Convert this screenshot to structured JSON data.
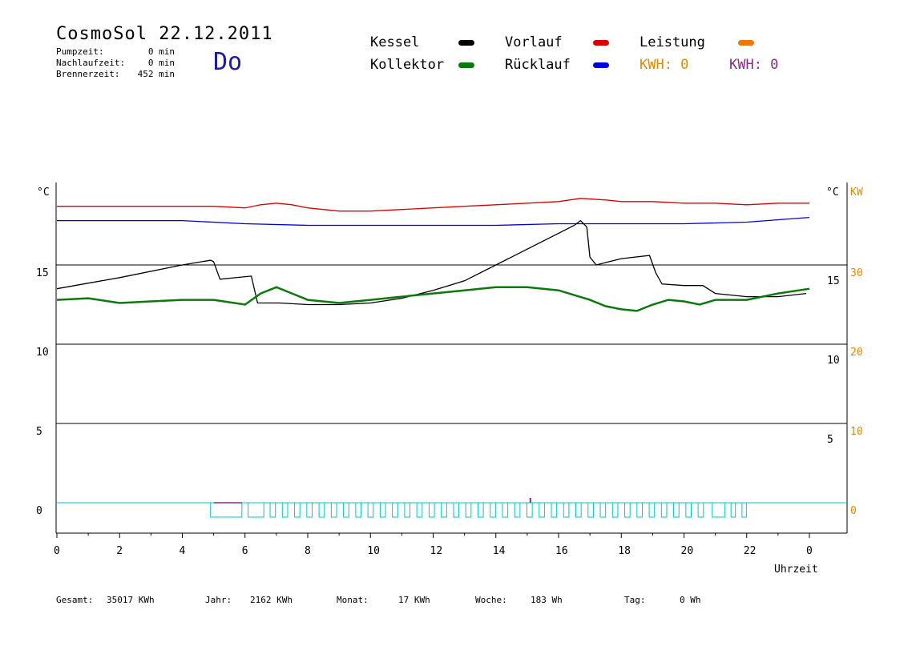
{
  "header": {
    "title": "CosmoSol 22.12.2011",
    "weekday": "Do",
    "stats": [
      {
        "label": "Pumpzeit:",
        "value": "0 min"
      },
      {
        "label": "Nachlaufzeit:",
        "value": "0 min"
      },
      {
        "label": "Brennerzeit:",
        "value": "452 min"
      }
    ]
  },
  "legend": {
    "items": [
      {
        "label": "Kessel",
        "color": "#000000"
      },
      {
        "label": "Kollektor",
        "color": "#0a7a0a"
      },
      {
        "label": "Vorlauf",
        "color": "#dd0000"
      },
      {
        "label": "Rücklauf",
        "color": "#0000dd"
      },
      {
        "label": "Leistung",
        "color": "#f07800"
      }
    ],
    "kwh_orange": "KWH: 0",
    "kwh_purple": "KWH: 0",
    "kwh_orange_color": "#e08a00",
    "kwh_purple_color": "#8a2a8a"
  },
  "footer": {
    "gesamt_label": "Gesamt:",
    "gesamt_value": "35017 KWh",
    "jahr_label": "Jahr:",
    "jahr_value": "2162 KWh",
    "monat_label": "Monat:",
    "monat_value": "17 KWh",
    "woche_label": "Woche:",
    "woche_value": "183 Wh",
    "tag_label": "Tag:",
    "tag_value": "0 Wh"
  },
  "chart_data": {
    "type": "line",
    "xlabel": "Uhrzeit",
    "x_tick_labels": [
      "0",
      "2",
      "4",
      "6",
      "8",
      "10",
      "12",
      "14",
      "16",
      "18",
      "20",
      "22",
      "0"
    ],
    "xlim": [
      0,
      24
    ],
    "left_axis": {
      "unit": "°C",
      "ticks": [
        "0",
        "5",
        "10",
        "15"
      ],
      "ylim": [
        0,
        20
      ]
    },
    "right_axis_inner": {
      "unit": "°C",
      "ticks": [
        "5",
        "10",
        "15"
      ]
    },
    "right_axis_outer": {
      "unit": "KW",
      "ticks": [
        "0",
        "10",
        "20",
        "30"
      ],
      "color": "#e08a00"
    },
    "grid": "horizontal",
    "series": [
      {
        "name": "Vorlauf",
        "color": "#dd0000",
        "x": [
          0,
          5,
          6,
          6.5,
          7,
          7.5,
          8,
          8.5,
          9,
          10,
          11,
          12,
          13,
          14,
          15,
          16,
          16.7,
          17.5,
          18,
          19,
          20,
          21,
          22,
          23,
          24
        ],
        "y": [
          18.7,
          18.7,
          18.6,
          18.8,
          18.9,
          18.8,
          18.6,
          18.5,
          18.4,
          18.4,
          18.5,
          18.6,
          18.7,
          18.8,
          18.9,
          19.0,
          19.2,
          19.1,
          19.0,
          19.0,
          18.9,
          18.9,
          18.8,
          18.9,
          18.9
        ]
      },
      {
        "name": "Rücklauf",
        "color": "#0000dd",
        "x": [
          0,
          4,
          6,
          8,
          10,
          12,
          14,
          16,
          18,
          20,
          22,
          24
        ],
        "y": [
          17.8,
          17.8,
          17.6,
          17.5,
          17.5,
          17.5,
          17.5,
          17.6,
          17.6,
          17.6,
          17.7,
          18.0
        ]
      },
      {
        "name": "Kessel",
        "color": "#000000",
        "x": [
          0,
          2,
          4,
          4.9,
          5.0,
          5.2,
          6.2,
          6.4,
          7.0,
          7.1,
          8,
          9,
          10,
          11,
          12,
          13,
          14,
          15,
          16,
          16.5,
          16.7,
          16.9,
          17.0,
          17.2,
          17.6,
          18,
          18.9,
          19.1,
          19.3,
          20,
          20.6,
          21,
          22,
          23,
          23.9
        ],
        "y": [
          13.5,
          14.2,
          15.0,
          15.3,
          15.2,
          14.1,
          14.3,
          12.6,
          12.6,
          12.6,
          12.5,
          12.5,
          12.6,
          12.9,
          13.4,
          14.0,
          15.0,
          16.0,
          17.0,
          17.5,
          17.8,
          17.4,
          15.5,
          15.0,
          15.2,
          15.4,
          15.6,
          14.5,
          13.8,
          13.7,
          13.7,
          13.2,
          13.0,
          13.0,
          13.2
        ]
      },
      {
        "name": "Kollektor",
        "color": "#0a7a0a",
        "x": [
          0,
          1,
          2,
          3,
          4,
          5,
          6,
          6.5,
          7,
          7.5,
          8,
          9,
          10,
          11,
          12,
          13,
          14,
          15,
          16,
          17,
          17.5,
          18,
          18.5,
          19,
          19.5,
          20,
          20.5,
          21,
          22,
          23,
          24
        ],
        "y": [
          12.8,
          12.9,
          12.6,
          12.7,
          12.8,
          12.8,
          12.5,
          13.2,
          13.6,
          13.2,
          12.8,
          12.6,
          12.8,
          13.0,
          13.2,
          13.4,
          13.6,
          13.6,
          13.4,
          12.8,
          12.4,
          12.2,
          12.1,
          12.5,
          12.8,
          12.7,
          12.5,
          12.8,
          12.8,
          13.2,
          13.5
        ]
      },
      {
        "name": "Kollektor (Pumpe)",
        "color": "#00c8c8",
        "x": [],
        "y": []
      }
    ]
  }
}
